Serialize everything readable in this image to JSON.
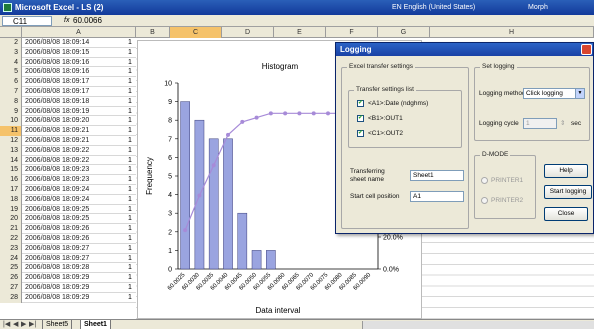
{
  "excel": {
    "title": "Microsoft Excel - LS (2)",
    "language": "EN English (United States)",
    "language_extra": "Morph",
    "namebox": "C11",
    "fx": "fx",
    "formula_value": "60.0066",
    "columns": [
      "A",
      "B",
      "C",
      "D",
      "E",
      "F",
      "G",
      "H"
    ],
    "selected_column": "C",
    "rows": [
      {
        "n": "2",
        "dt": "2006/08/08 18:09:14",
        "v": "1"
      },
      {
        "n": "3",
        "dt": "2006/08/08 18:09:15",
        "v": "1"
      },
      {
        "n": "4",
        "dt": "2006/08/08 18:09:16",
        "v": "1"
      },
      {
        "n": "5",
        "dt": "2006/08/08 18:09:16",
        "v": "1"
      },
      {
        "n": "6",
        "dt": "2006/08/08 18:09:17",
        "v": "1"
      },
      {
        "n": "7",
        "dt": "2006/08/08 18:09:17",
        "v": "1"
      },
      {
        "n": "8",
        "dt": "2006/08/08 18:09:18",
        "v": "1"
      },
      {
        "n": "9",
        "dt": "2006/08/08 18:09:19",
        "v": "1"
      },
      {
        "n": "10",
        "dt": "2006/08/08 18:09:20",
        "v": "1"
      },
      {
        "n": "11",
        "dt": "2006/08/08 18:09:21",
        "v": "1"
      },
      {
        "n": "12",
        "dt": "2006/08/08 18:09:21",
        "v": "1"
      },
      {
        "n": "13",
        "dt": "2006/08/08 18:09:22",
        "v": "1"
      },
      {
        "n": "14",
        "dt": "2006/08/08 18:09:22",
        "v": "1"
      },
      {
        "n": "15",
        "dt": "2006/08/08 18:09:23",
        "v": "1"
      },
      {
        "n": "16",
        "dt": "2006/08/08 18:09:23",
        "v": "1"
      },
      {
        "n": "17",
        "dt": "2006/08/08 18:09:24",
        "v": "1"
      },
      {
        "n": "18",
        "dt": "2006/08/08 18:09:24",
        "v": "1"
      },
      {
        "n": "19",
        "dt": "2006/08/08 18:09:25",
        "v": "1"
      },
      {
        "n": "20",
        "dt": "2006/08/08 18:09:25",
        "v": "1"
      },
      {
        "n": "21",
        "dt": "2006/08/08 18:09:26",
        "v": "1"
      },
      {
        "n": "22",
        "dt": "2006/08/08 18:09:26",
        "v": "1"
      },
      {
        "n": "23",
        "dt": "2006/08/08 18:09:27",
        "v": "1"
      },
      {
        "n": "24",
        "dt": "2006/08/08 18:09:27",
        "v": "1"
      },
      {
        "n": "25",
        "dt": "2006/08/08 18:09:28",
        "v": "1"
      },
      {
        "n": "26",
        "dt": "2006/08/08 18:09:29",
        "v": "1"
      },
      {
        "n": "27",
        "dt": "2006/08/08 18:09:29",
        "v": "1"
      },
      {
        "n": "28",
        "dt": "2006/08/08 18:09:29",
        "v": "1"
      }
    ],
    "selected_row": "11",
    "nav_buttons": [
      "|◀",
      "◀",
      "▶",
      "▶|"
    ],
    "sheet_tabs": [
      "Sheet5",
      "Sheet1"
    ],
    "active_sheet": "Sheet1"
  },
  "chart_data": {
    "type": "bar",
    "title": "Histogram",
    "xlabel": "Data interval",
    "ylabel": "Frequency",
    "categories": [
      "60.0025",
      "60.0030",
      "60.0035",
      "60.0040",
      "60.0045",
      "60.0050",
      "60.0055",
      "60.0060",
      "60.0065",
      "60.0070",
      "60.0075",
      "60.0080",
      "60.0085",
      "60.0090"
    ],
    "series": [
      {
        "type": "bar",
        "values": [
          9,
          8,
          7,
          7,
          3,
          1,
          1,
          0,
          0,
          0,
          0,
          0,
          0,
          0
        ]
      },
      {
        "type": "line",
        "axis": "right",
        "values": [
          20.9,
          39.5,
          55.8,
          72.1,
          79.1,
          81.4,
          83.7,
          83.7,
          83.7,
          83.7,
          83.7,
          83.7,
          83.7,
          83.7
        ]
      }
    ],
    "ylim": [
      0,
      10
    ],
    "yticks": [
      "0",
      "1",
      "2",
      "3",
      "4",
      "5",
      "6",
      "7",
      "8",
      "9",
      "10"
    ],
    "y2ticks": [
      "0.0%",
      "20.0%"
    ],
    "grid": false,
    "bar_color": "#9aa4e0",
    "line_color": "#a78bd8"
  },
  "dialog": {
    "title": "Logging",
    "excel_transfer": {
      "legend": "Excel transfer settings",
      "transfer_list": {
        "legend": "Transfer settings list",
        "items": [
          {
            "label": "<A1>:Date (ndghms)",
            "checked": "✔"
          },
          {
            "label": "<B1>:OUT1",
            "checked": "✔"
          },
          {
            "label": "<C1>:OUT2",
            "checked": "✔"
          }
        ]
      },
      "sheet_label": "Transferring sheet name",
      "sheet_value": "Sheet1",
      "start_cell_label": "Start cell position",
      "start_cell_value": "A1"
    },
    "set_logging": {
      "legend": "Set logging",
      "method_label": "Logging method",
      "method_value": "Click logging",
      "cycle_label": "Logging cycle",
      "cycle_value": "1",
      "cycle_unit": "sec"
    },
    "dmode": {
      "legend": "D-MODE",
      "options": [
        "PRINTER1",
        "PRINTER2"
      ]
    },
    "buttons": {
      "help": "Help",
      "start": "Start logging",
      "close": "Close"
    }
  }
}
